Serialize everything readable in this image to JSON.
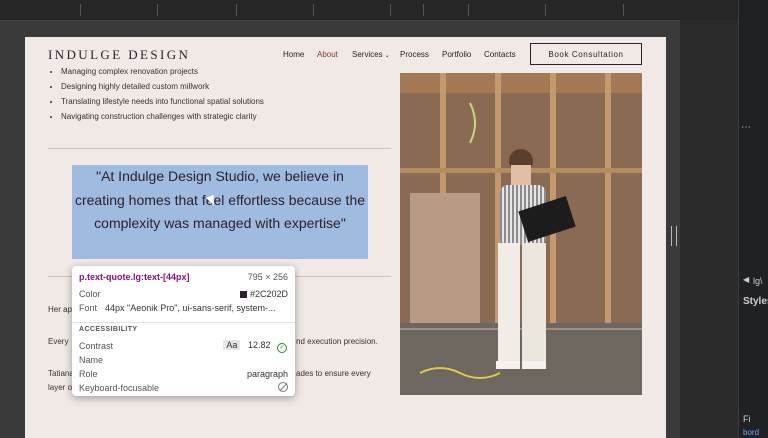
{
  "site": {
    "logo": "INDULGE DESIGN",
    "nav": [
      "Home",
      "About",
      "Services",
      "Process",
      "Portfolio",
      "Contacts"
    ],
    "cta": "Book Consultation",
    "bullets": [
      "Managing complex renovation projects",
      "Designing highly detailed custom millwork",
      "Translating lifestyle needs into functional spatial solutions",
      "Navigating construction challenges with strategic clarity"
    ],
    "quote": "\"At Indulge Design Studio, we believe in creating homes that feel effortless because the complexity was managed with expertise\"",
    "para1": "Her ap",
    "para2_start": "Every",
    "para2_end": "nd execution precision.",
    "para3_start": "Tatiana",
    "para3_end": "ades to ensure every",
    "para3_line2": "layer o"
  },
  "tooltip": {
    "selector": "p.text-quote.lg:text-[44px]",
    "size": "795 × 256",
    "color_label": "Color",
    "color_value": "#2C202D",
    "font_label": "Font",
    "font_value": "44px \"Aeonik Pro\", ui-sans-serif, system-...",
    "section": "ACCESSIBILITY",
    "contrast_label": "Contrast",
    "contrast_badge": "Aa",
    "contrast_value": "12.82",
    "name_label": "Name",
    "role_label": "Role",
    "role_value": "paragraph",
    "kbd_label": "Keyboard-focusable"
  },
  "devtools": {
    "tag_text": "lg\\",
    "styles_label": "Styles",
    "filter_label": "Fi",
    "bottom_text": "bord",
    "dots": "⋯",
    "arrow": "◀"
  },
  "colors": {
    "page_bg": "#f0e9e6",
    "text": "#2c202d",
    "highlight": "#9fbbe0",
    "accent": "#8a3a2a"
  }
}
